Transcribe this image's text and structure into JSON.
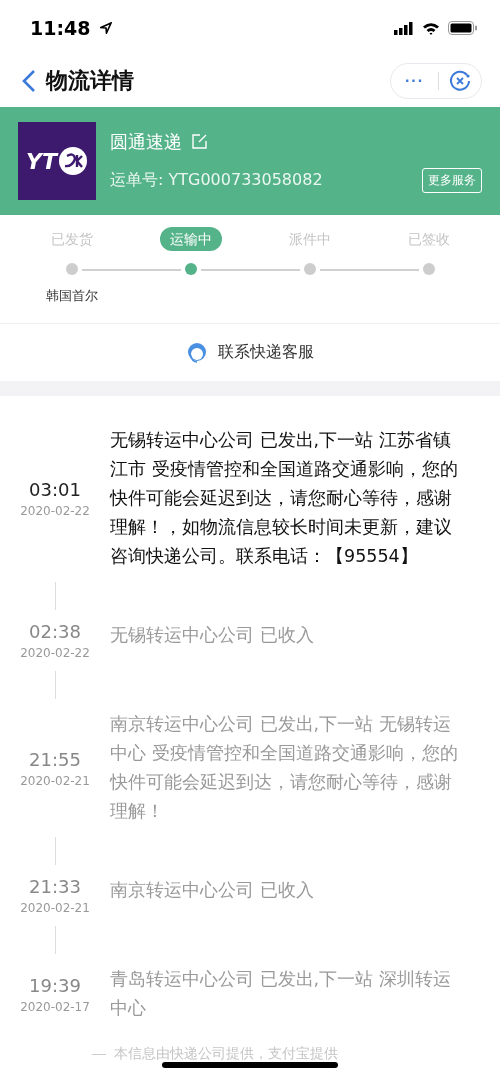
{
  "status_bar": {
    "time": "11:48"
  },
  "nav": {
    "title": "物流详情",
    "more": "···"
  },
  "carrier": {
    "logo_text": "YT",
    "name": "圆通速递",
    "waybill_label": "运单号:",
    "waybill": "YTG000733058082",
    "more_button": "更多服务"
  },
  "progress": [
    {
      "label": "已发货",
      "selected": false,
      "place": "韩国首尔"
    },
    {
      "label": "运输中",
      "selected": true
    },
    {
      "label": "派件中",
      "selected": false
    },
    {
      "label": "已签收",
      "selected": false
    }
  ],
  "contact": {
    "label": "联系快递客服"
  },
  "events": [
    {
      "time": "03:01",
      "date": "2020-02-22",
      "text": "无锡转运中心公司 已发出,下一站 江苏省镇江市 受疫情管控和全国道路交通影响，您的快件可能会延迟到达，请您耐心等待，感谢理解！，如物流信息较长时间未更新，建议咨询快递公司。联系电话：【95554】",
      "latest": true
    },
    {
      "time": "02:38",
      "date": "2020-02-22",
      "text": "无锡转运中心公司 已收入",
      "latest": false
    },
    {
      "time": "21:55",
      "date": "2020-02-21",
      "text": "南京转运中心公司 已发出,下一站 无锡转运中心 受疫情管控和全国道路交通影响，您的快件可能会延迟到达，请您耐心等待，感谢理解！",
      "latest": false
    },
    {
      "time": "21:33",
      "date": "2020-02-21",
      "text": "南京转运中心公司 已收入",
      "latest": false
    },
    {
      "time": "19:39",
      "date": "2020-02-17",
      "text": "青岛转运中心公司 已发出,下一站 深圳转运中心",
      "latest": false
    }
  ],
  "footer": {
    "note": "本信息由快递公司提供，支付宝提供"
  }
}
